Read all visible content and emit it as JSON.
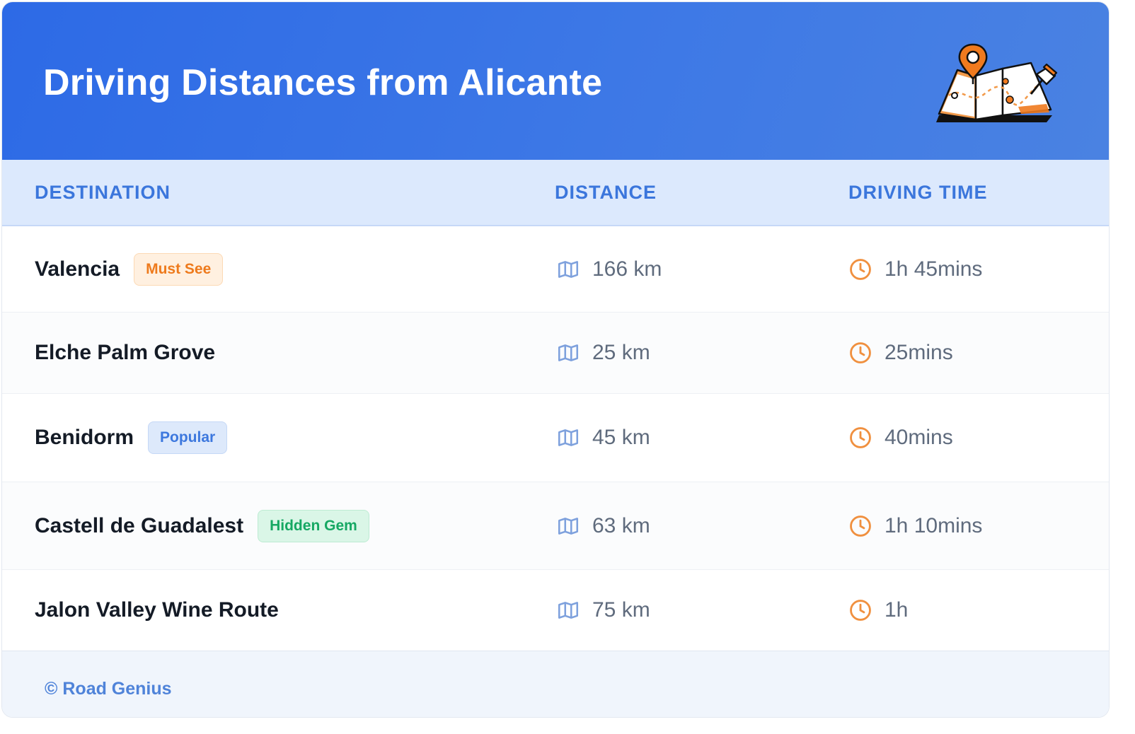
{
  "header": {
    "title": "Driving Distances from Alicante",
    "illustration_icon": "folded-map-with-pins-icon"
  },
  "table": {
    "columns": {
      "destination": "DESTINATION",
      "distance": "DISTANCE",
      "driving_time": "DRIVING TIME"
    },
    "rows": [
      {
        "destination": "Valencia",
        "badge": "Must See",
        "badge_color": "#ee7a1c",
        "distance": "166 km",
        "time": "1h 45mins"
      },
      {
        "destination": "Elche Palm Grove",
        "badge": "",
        "distance": "25 km",
        "time": "25mins"
      },
      {
        "destination": "Benidorm",
        "badge": "Popular",
        "badge_color": "#3d78de",
        "distance": "45 km",
        "time": "40mins"
      },
      {
        "destination": "Castell de Guadalest",
        "badge": "Hidden Gem",
        "badge_color": "#16a863",
        "distance": "63 km",
        "time": "1h 10mins"
      },
      {
        "destination": "Jalon Valley Wine Route",
        "badge": "",
        "distance": "75 km",
        "time": "1h"
      }
    ],
    "distance_icon": "map-icon",
    "time_icon": "clock-icon"
  },
  "footer": {
    "copyright": "© Road Genius"
  },
  "colors": {
    "header_blue": "#2d6ae6",
    "accent_orange": "#ee7a1c",
    "header_text": "#3b76dc"
  }
}
